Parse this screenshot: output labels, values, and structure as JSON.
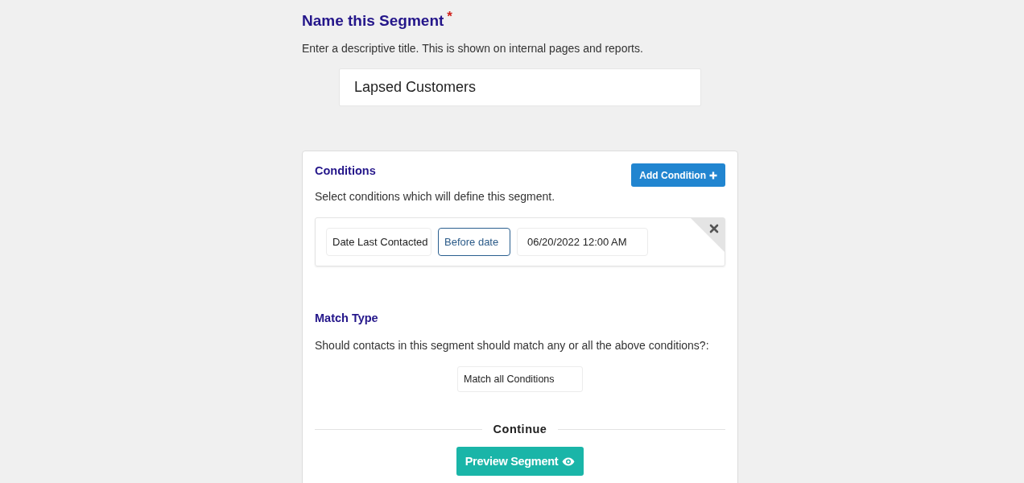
{
  "name_section": {
    "title": "Name this Segment",
    "required_mark": "*",
    "description": "Enter a descriptive title. This is shown on internal pages and reports.",
    "name_field": {
      "value": "Lapsed Customers"
    }
  },
  "conditions": {
    "title": "Conditions",
    "add_button": "Add Condition",
    "description": "Select conditions which will define this segment.",
    "rows": [
      {
        "fields": [
          {
            "value": "Date Last Contacted",
            "focused": false
          },
          {
            "value": "Before date",
            "focused": true
          },
          {
            "value": "06/20/2022 12:00 AM",
            "focused": false
          }
        ]
      }
    ]
  },
  "match_type": {
    "title": "Match Type",
    "description": "Should contacts in this segment should match any or all the above conditions?:",
    "select": {
      "value": "Match all Conditions"
    }
  },
  "continue_divider": "Continue",
  "preview_button": "Preview Segment"
}
